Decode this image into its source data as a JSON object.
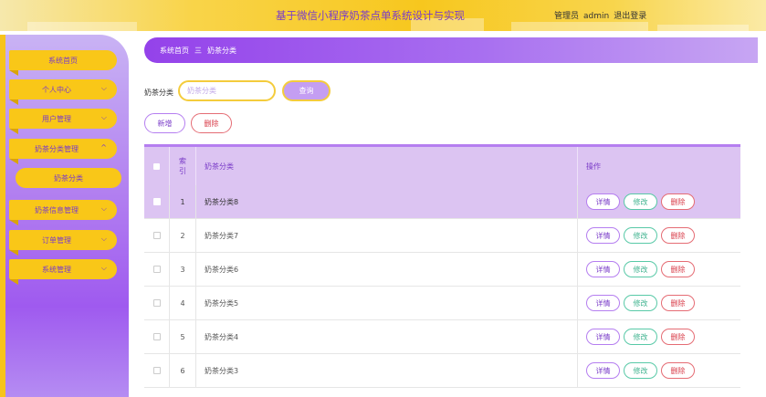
{
  "app": {
    "title": "基于微信小程序奶茶点单系统设计与实现"
  },
  "user": {
    "role": "管理员",
    "name": "admin",
    "logout": "退出登录"
  },
  "sidebar": {
    "items": [
      {
        "label": "系统首页"
      },
      {
        "label": "个人中心"
      },
      {
        "label": "用户管理"
      },
      {
        "label": "奶茶分类管理"
      },
      {
        "label": "奶茶信息管理"
      },
      {
        "label": "订单管理"
      },
      {
        "label": "系统管理"
      }
    ],
    "submenu": {
      "label": "奶茶分类"
    }
  },
  "breadcrumb": {
    "home": "系统首页",
    "separator": "三",
    "current": "奶茶分类"
  },
  "search": {
    "label": "奶茶分类",
    "placeholder": "奶茶分类",
    "button": "查询"
  },
  "actions": {
    "add": "新增",
    "delete": "删除"
  },
  "table": {
    "headers": {
      "index": "索",
      "index2": "引",
      "name": "奶茶分类",
      "ops": "操作"
    },
    "rows": [
      {
        "index": "1",
        "name": "奶茶分类8"
      },
      {
        "index": "2",
        "name": "奶茶分类7"
      },
      {
        "index": "3",
        "name": "奶茶分类6"
      },
      {
        "index": "4",
        "name": "奶茶分类5"
      },
      {
        "index": "5",
        "name": "奶茶分类4"
      },
      {
        "index": "6",
        "name": "奶茶分类3"
      }
    ],
    "row_actions": {
      "detail": "详情",
      "edit": "修改",
      "remove": "删除"
    }
  },
  "colors": {
    "accent": "#9442ea",
    "brand_yellow": "#f9c718",
    "delete_red": "#d83c48",
    "edit_green": "#3fb38f"
  }
}
